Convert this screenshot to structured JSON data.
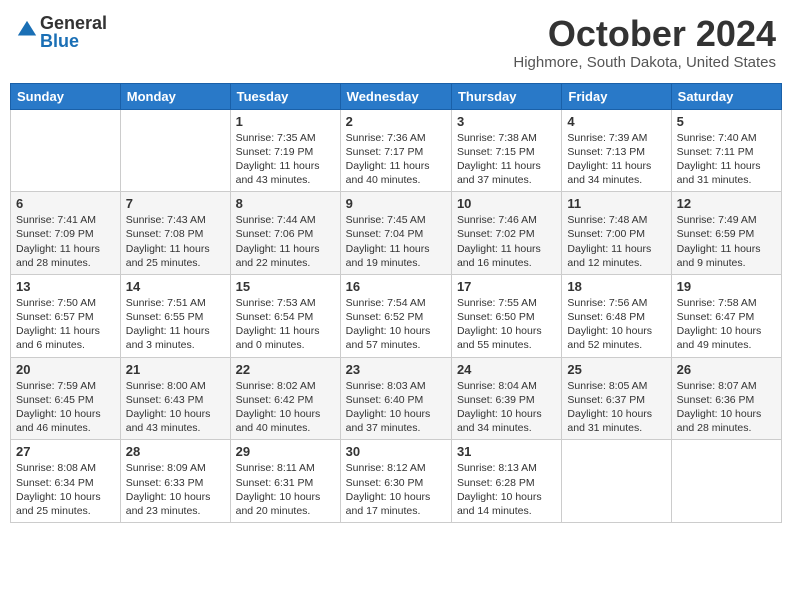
{
  "header": {
    "logo_general": "General",
    "logo_blue": "Blue",
    "month_title": "October 2024",
    "subtitle": "Highmore, South Dakota, United States"
  },
  "weekdays": [
    "Sunday",
    "Monday",
    "Tuesday",
    "Wednesday",
    "Thursday",
    "Friday",
    "Saturday"
  ],
  "weeks": [
    [
      {
        "day": "",
        "sunrise": "",
        "sunset": "",
        "daylight": ""
      },
      {
        "day": "",
        "sunrise": "",
        "sunset": "",
        "daylight": ""
      },
      {
        "day": "1",
        "sunrise": "Sunrise: 7:35 AM",
        "sunset": "Sunset: 7:19 PM",
        "daylight": "Daylight: 11 hours and 43 minutes."
      },
      {
        "day": "2",
        "sunrise": "Sunrise: 7:36 AM",
        "sunset": "Sunset: 7:17 PM",
        "daylight": "Daylight: 11 hours and 40 minutes."
      },
      {
        "day": "3",
        "sunrise": "Sunrise: 7:38 AM",
        "sunset": "Sunset: 7:15 PM",
        "daylight": "Daylight: 11 hours and 37 minutes."
      },
      {
        "day": "4",
        "sunrise": "Sunrise: 7:39 AM",
        "sunset": "Sunset: 7:13 PM",
        "daylight": "Daylight: 11 hours and 34 minutes."
      },
      {
        "day": "5",
        "sunrise": "Sunrise: 7:40 AM",
        "sunset": "Sunset: 7:11 PM",
        "daylight": "Daylight: 11 hours and 31 minutes."
      }
    ],
    [
      {
        "day": "6",
        "sunrise": "Sunrise: 7:41 AM",
        "sunset": "Sunset: 7:09 PM",
        "daylight": "Daylight: 11 hours and 28 minutes."
      },
      {
        "day": "7",
        "sunrise": "Sunrise: 7:43 AM",
        "sunset": "Sunset: 7:08 PM",
        "daylight": "Daylight: 11 hours and 25 minutes."
      },
      {
        "day": "8",
        "sunrise": "Sunrise: 7:44 AM",
        "sunset": "Sunset: 7:06 PM",
        "daylight": "Daylight: 11 hours and 22 minutes."
      },
      {
        "day": "9",
        "sunrise": "Sunrise: 7:45 AM",
        "sunset": "Sunset: 7:04 PM",
        "daylight": "Daylight: 11 hours and 19 minutes."
      },
      {
        "day": "10",
        "sunrise": "Sunrise: 7:46 AM",
        "sunset": "Sunset: 7:02 PM",
        "daylight": "Daylight: 11 hours and 16 minutes."
      },
      {
        "day": "11",
        "sunrise": "Sunrise: 7:48 AM",
        "sunset": "Sunset: 7:00 PM",
        "daylight": "Daylight: 11 hours and 12 minutes."
      },
      {
        "day": "12",
        "sunrise": "Sunrise: 7:49 AM",
        "sunset": "Sunset: 6:59 PM",
        "daylight": "Daylight: 11 hours and 9 minutes."
      }
    ],
    [
      {
        "day": "13",
        "sunrise": "Sunrise: 7:50 AM",
        "sunset": "Sunset: 6:57 PM",
        "daylight": "Daylight: 11 hours and 6 minutes."
      },
      {
        "day": "14",
        "sunrise": "Sunrise: 7:51 AM",
        "sunset": "Sunset: 6:55 PM",
        "daylight": "Daylight: 11 hours and 3 minutes."
      },
      {
        "day": "15",
        "sunrise": "Sunrise: 7:53 AM",
        "sunset": "Sunset: 6:54 PM",
        "daylight": "Daylight: 11 hours and 0 minutes."
      },
      {
        "day": "16",
        "sunrise": "Sunrise: 7:54 AM",
        "sunset": "Sunset: 6:52 PM",
        "daylight": "Daylight: 10 hours and 57 minutes."
      },
      {
        "day": "17",
        "sunrise": "Sunrise: 7:55 AM",
        "sunset": "Sunset: 6:50 PM",
        "daylight": "Daylight: 10 hours and 55 minutes."
      },
      {
        "day": "18",
        "sunrise": "Sunrise: 7:56 AM",
        "sunset": "Sunset: 6:48 PM",
        "daylight": "Daylight: 10 hours and 52 minutes."
      },
      {
        "day": "19",
        "sunrise": "Sunrise: 7:58 AM",
        "sunset": "Sunset: 6:47 PM",
        "daylight": "Daylight: 10 hours and 49 minutes."
      }
    ],
    [
      {
        "day": "20",
        "sunrise": "Sunrise: 7:59 AM",
        "sunset": "Sunset: 6:45 PM",
        "daylight": "Daylight: 10 hours and 46 minutes."
      },
      {
        "day": "21",
        "sunrise": "Sunrise: 8:00 AM",
        "sunset": "Sunset: 6:43 PM",
        "daylight": "Daylight: 10 hours and 43 minutes."
      },
      {
        "day": "22",
        "sunrise": "Sunrise: 8:02 AM",
        "sunset": "Sunset: 6:42 PM",
        "daylight": "Daylight: 10 hours and 40 minutes."
      },
      {
        "day": "23",
        "sunrise": "Sunrise: 8:03 AM",
        "sunset": "Sunset: 6:40 PM",
        "daylight": "Daylight: 10 hours and 37 minutes."
      },
      {
        "day": "24",
        "sunrise": "Sunrise: 8:04 AM",
        "sunset": "Sunset: 6:39 PM",
        "daylight": "Daylight: 10 hours and 34 minutes."
      },
      {
        "day": "25",
        "sunrise": "Sunrise: 8:05 AM",
        "sunset": "Sunset: 6:37 PM",
        "daylight": "Daylight: 10 hours and 31 minutes."
      },
      {
        "day": "26",
        "sunrise": "Sunrise: 8:07 AM",
        "sunset": "Sunset: 6:36 PM",
        "daylight": "Daylight: 10 hours and 28 minutes."
      }
    ],
    [
      {
        "day": "27",
        "sunrise": "Sunrise: 8:08 AM",
        "sunset": "Sunset: 6:34 PM",
        "daylight": "Daylight: 10 hours and 25 minutes."
      },
      {
        "day": "28",
        "sunrise": "Sunrise: 8:09 AM",
        "sunset": "Sunset: 6:33 PM",
        "daylight": "Daylight: 10 hours and 23 minutes."
      },
      {
        "day": "29",
        "sunrise": "Sunrise: 8:11 AM",
        "sunset": "Sunset: 6:31 PM",
        "daylight": "Daylight: 10 hours and 20 minutes."
      },
      {
        "day": "30",
        "sunrise": "Sunrise: 8:12 AM",
        "sunset": "Sunset: 6:30 PM",
        "daylight": "Daylight: 10 hours and 17 minutes."
      },
      {
        "day": "31",
        "sunrise": "Sunrise: 8:13 AM",
        "sunset": "Sunset: 6:28 PM",
        "daylight": "Daylight: 10 hours and 14 minutes."
      },
      {
        "day": "",
        "sunrise": "",
        "sunset": "",
        "daylight": ""
      },
      {
        "day": "",
        "sunrise": "",
        "sunset": "",
        "daylight": ""
      }
    ]
  ]
}
